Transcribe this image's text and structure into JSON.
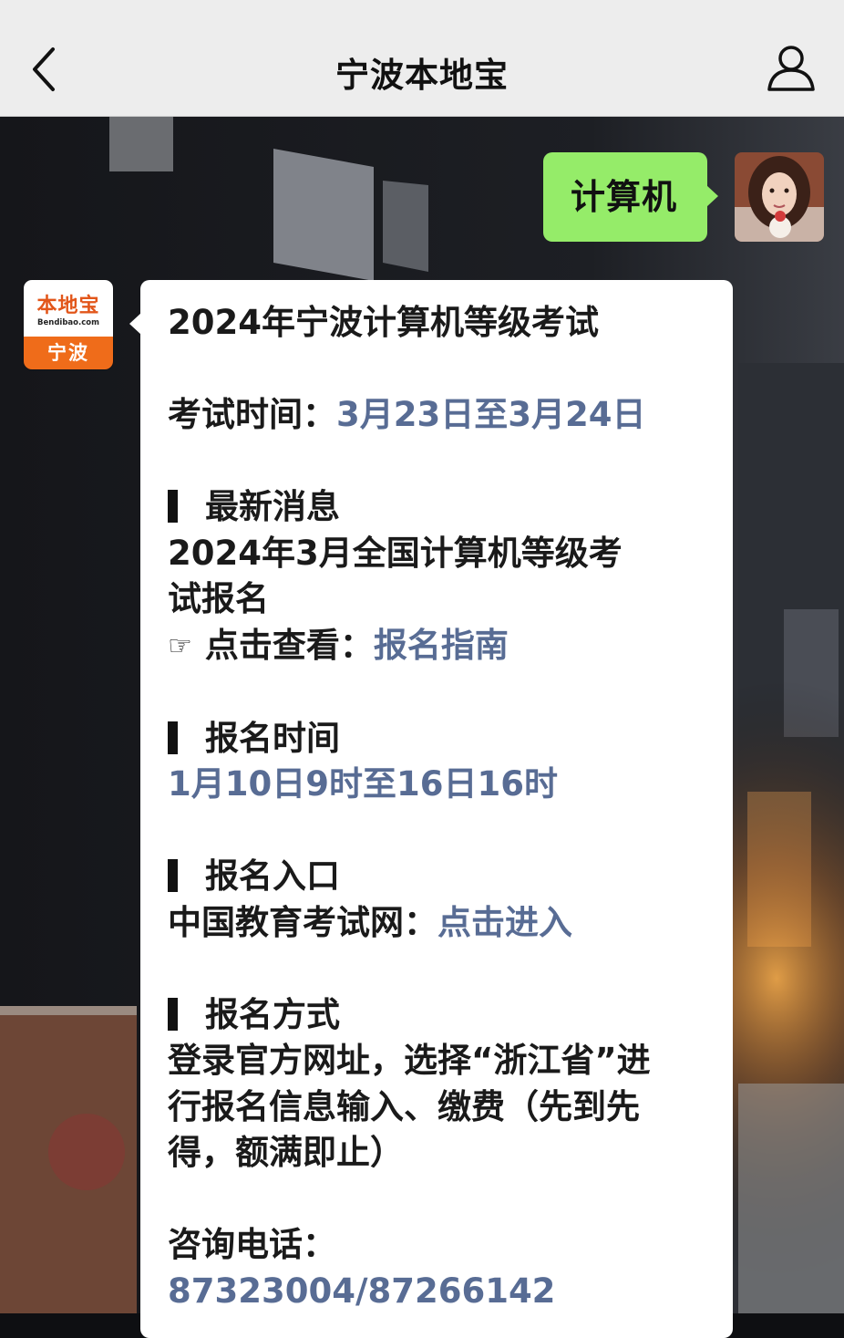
{
  "header": {
    "title": "宁波本地宝"
  },
  "outgoing_message": {
    "text": "计算机"
  },
  "bot": {
    "avatar_brand": "本地宝",
    "avatar_site": "Bendibao.com",
    "avatar_city": "宁波"
  },
  "card": {
    "title": "2024年宁波计算机等级考试",
    "exam_time_label": "考试时间：",
    "exam_time_value": "3月23日至3月24日",
    "bar_symbol": "▍",
    "latest_news_heading": "最新消息",
    "latest_news_line1": "2024年3月全国计算机等级考",
    "latest_news_line2": "试报名",
    "pointer_icon_glyph": "☞",
    "view_label": "点击查看：",
    "view_link": "报名指南",
    "reg_time_heading": "报名时间",
    "reg_time_value": "1月10日9时至16日16时",
    "reg_entry_heading": "报名入口",
    "reg_entry_label": "中国教育考试网：",
    "reg_entry_link": "点击进入",
    "reg_method_heading": "报名方式",
    "reg_method_line1": "登录官方网址，选择“浙江省”进",
    "reg_method_line2": "行报名信息输入、缴费（先到先",
    "reg_method_line3": "得，额满即止）",
    "phone_label": "咨询电话：",
    "phone_value": "87323004/87266142"
  },
  "colors": {
    "header_bg": "#ededed",
    "outgoing_bubble": "#95ec69",
    "link": "#586c94",
    "brand_orange": "#ef6c1a"
  }
}
